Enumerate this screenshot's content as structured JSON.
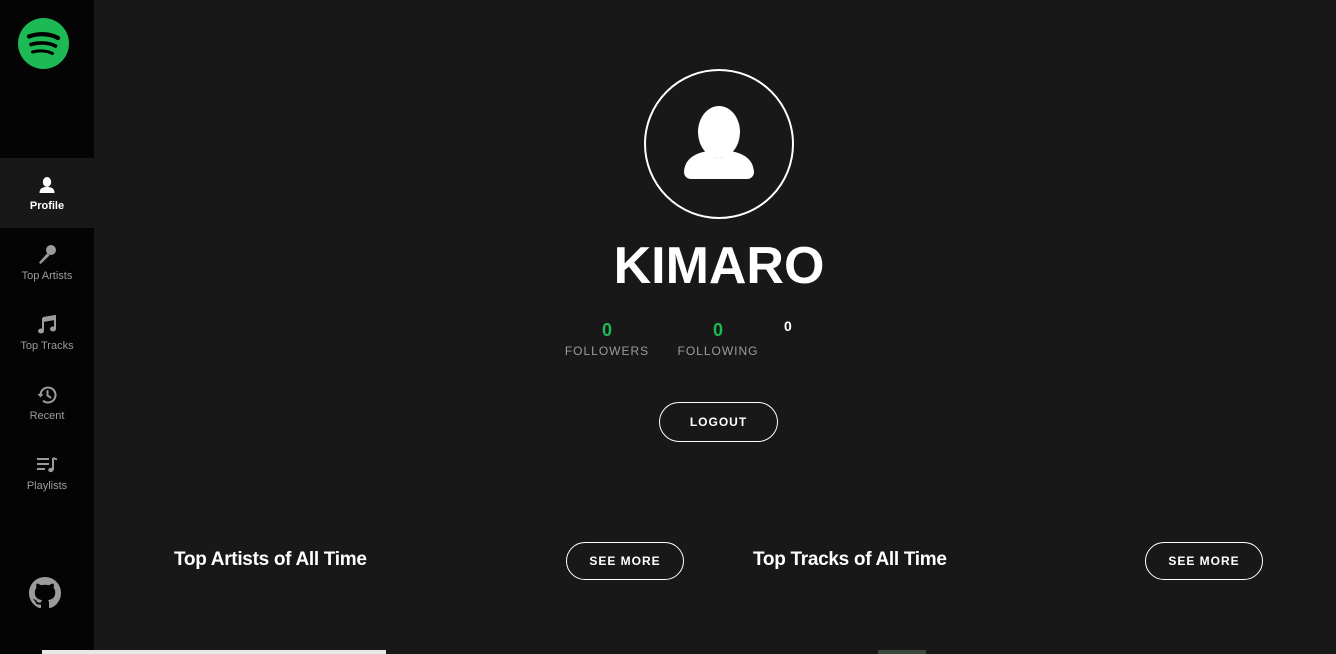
{
  "sidebar": {
    "logo_icon": "spotify-logo-icon",
    "items": [
      {
        "label": "Profile",
        "icon": "user-icon",
        "active": true
      },
      {
        "label": "Top Artists",
        "icon": "microphone-icon"
      },
      {
        "label": "Top Tracks",
        "icon": "music-note-icon"
      },
      {
        "label": "Recent",
        "icon": "history-icon"
      },
      {
        "label": "Playlists",
        "icon": "playlist-icon"
      }
    ],
    "github_icon": "github-icon"
  },
  "profile": {
    "avatar_icon": "user-placeholder-icon",
    "username": "KIMARO",
    "followers_value": "0",
    "followers_label": "FOLLOWERS",
    "following_value": "0",
    "following_label": "FOLLOWING",
    "extra_value": "0",
    "logout_label": "LOGOUT"
  },
  "sections": {
    "top_artists_title": "Top Artists of All Time",
    "top_artists_button": "SEE MORE",
    "top_tracks_title": "Top Tracks of All Time",
    "top_tracks_button": "SEE MORE"
  },
  "colors": {
    "accent": "#1db954",
    "background": "#181818",
    "sidebar": "#040404"
  }
}
